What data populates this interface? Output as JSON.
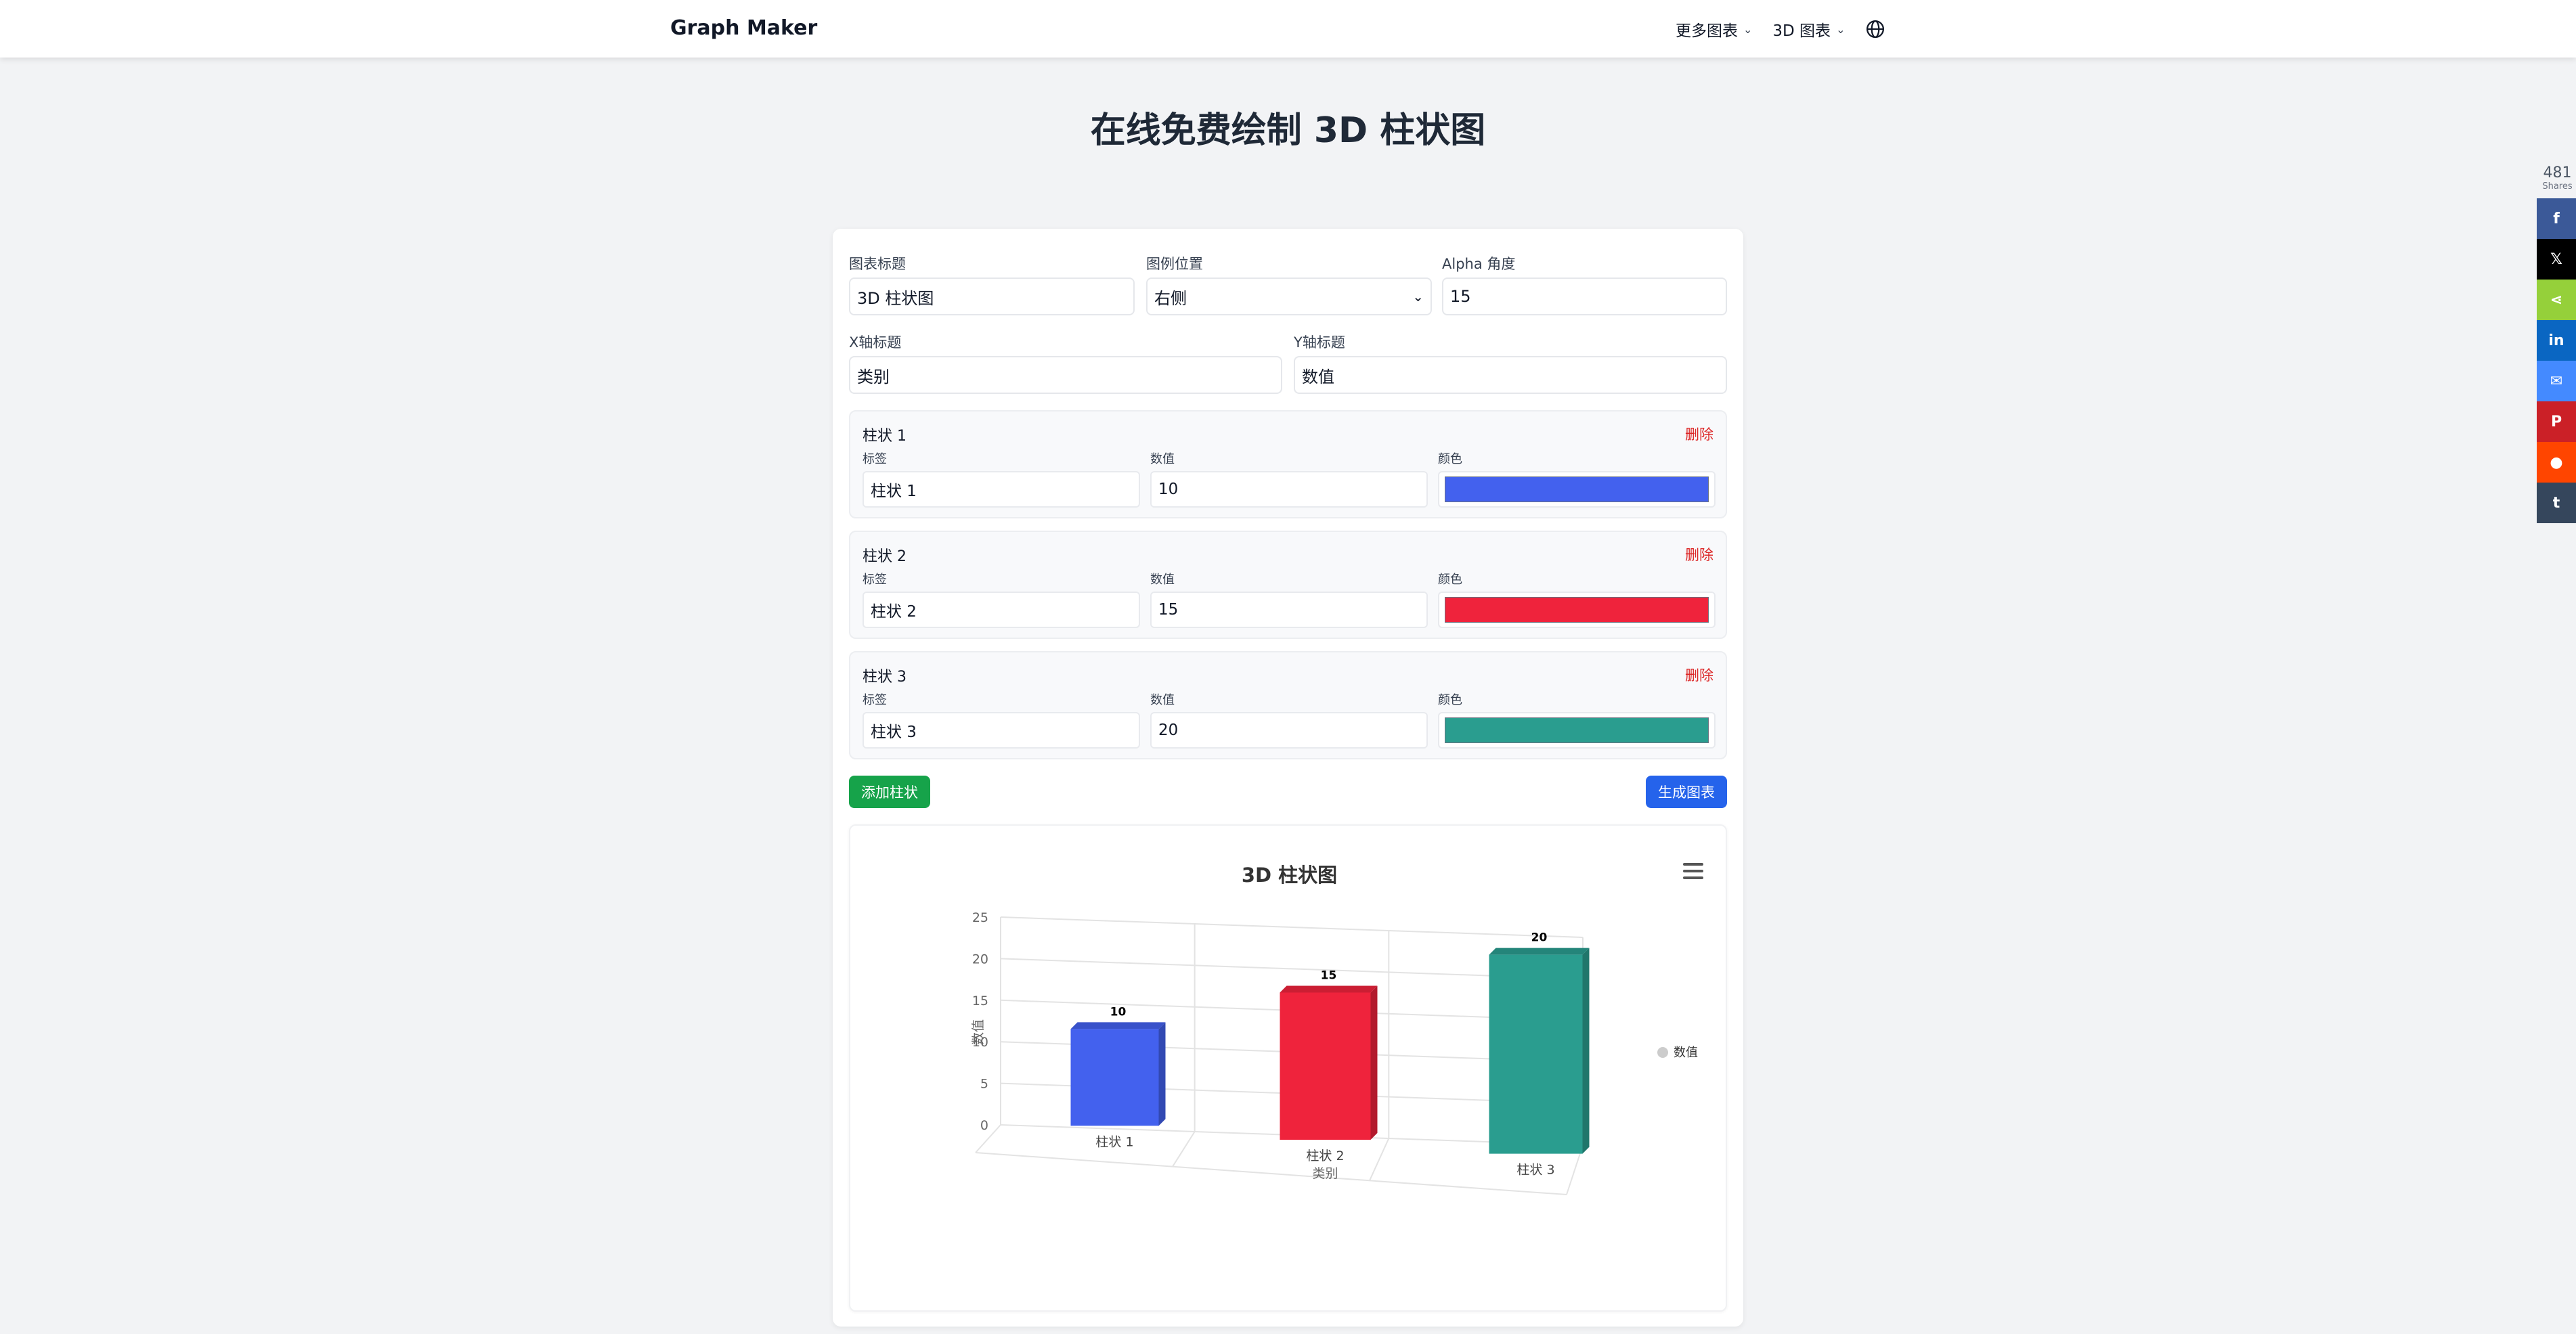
{
  "nav": {
    "brand": "Graph Maker",
    "more_charts": "更多图表",
    "charts_3d": "3D 图表"
  },
  "page": {
    "title": "在线免费绘制 3D 柱状图"
  },
  "form": {
    "chart_title_label": "图表标题",
    "chart_title_value": "3D 柱状图",
    "legend_position_label": "图例位置",
    "legend_position_value": "右侧",
    "alpha_label": "Alpha 角度",
    "alpha_value": "15",
    "x_title_label": "X轴标题",
    "x_title_value": "类别",
    "y_title_label": "Y轴标题",
    "y_title_value": "数值"
  },
  "bars": [
    {
      "title": "柱状 1",
      "delete": "删除",
      "label_caption": "标签",
      "value_caption": "数值",
      "color_caption": "颜色",
      "label": "柱状 1",
      "value": "10",
      "color": "#4361ee"
    },
    {
      "title": "柱状 2",
      "delete": "删除",
      "label_caption": "标签",
      "value_caption": "数值",
      "color_caption": "颜色",
      "label": "柱状 2",
      "value": "15",
      "color": "#ef233c"
    },
    {
      "title": "柱状 3",
      "delete": "删除",
      "label_caption": "标签",
      "value_caption": "数值",
      "color_caption": "颜色",
      "label": "柱状 3",
      "value": "20",
      "color": "#2a9d8f"
    }
  ],
  "buttons": {
    "add_bar": "添加柱状",
    "generate": "生成图表",
    "add_color": "#16a34a",
    "generate_color": "#2563eb"
  },
  "chart_data": {
    "type": "bar",
    "title": "3D 柱状图",
    "categories": [
      "柱状 1",
      "柱状 2",
      "柱状 3"
    ],
    "values": [
      10,
      15,
      20
    ],
    "colors": [
      "#4361ee",
      "#ef233c",
      "#2a9d8f"
    ],
    "xlabel": "类别",
    "ylabel": "数值",
    "ylim": [
      0,
      25
    ],
    "yticks": [
      0,
      5,
      10,
      15,
      20,
      25
    ],
    "grid": true,
    "legend": {
      "position": "right",
      "entries": [
        "数值"
      ]
    },
    "alpha": 15
  },
  "share": {
    "count": "481",
    "count_label": "Shares",
    "buttons": [
      {
        "icon": "facebook-icon",
        "glyph": "f",
        "color": "#3b5998"
      },
      {
        "icon": "x-icon",
        "glyph": "𝕏",
        "color": "#000000"
      },
      {
        "icon": "share-icon",
        "glyph": "⋖",
        "color": "#95d03a"
      },
      {
        "icon": "linkedin-icon",
        "glyph": "in",
        "color": "#0a66c2"
      },
      {
        "icon": "messenger-icon",
        "glyph": "✉",
        "color": "#448aff"
      },
      {
        "icon": "pinterest-icon",
        "glyph": "P",
        "color": "#cb2027"
      },
      {
        "icon": "reddit-icon",
        "glyph": "●",
        "color": "#ff4500"
      },
      {
        "icon": "tumblr-icon",
        "glyph": "t",
        "color": "#35465c"
      }
    ]
  }
}
